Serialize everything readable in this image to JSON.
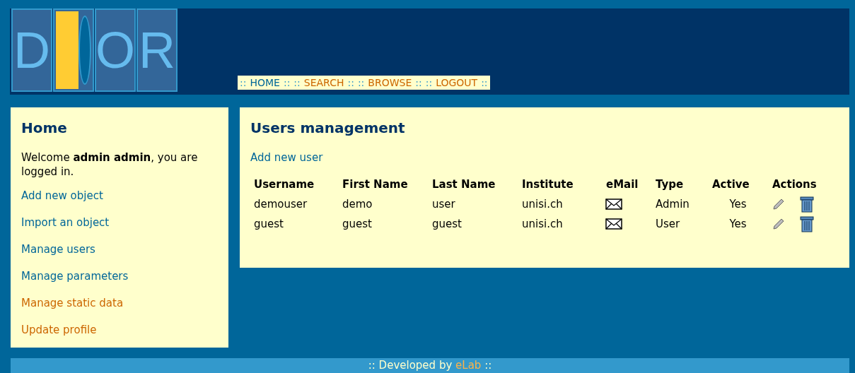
{
  "logo": {
    "tiles": [
      {
        "kind": "letter",
        "text": "D"
      },
      {
        "kind": "door"
      },
      {
        "kind": "letter",
        "text": "O"
      },
      {
        "kind": "letter",
        "text": "R"
      }
    ]
  },
  "nav": {
    "separator": "::",
    "items": [
      {
        "label": "HOME",
        "selected": true
      },
      {
        "label": "SEARCH",
        "selected": false
      },
      {
        "label": "BROWSE",
        "selected": false
      },
      {
        "label": "LOGOUT",
        "selected": false
      }
    ]
  },
  "sidebar": {
    "title": "Home",
    "welcome": "Welcome **admin admin**, you are logged in.",
    "links": [
      {
        "label": "Add new object",
        "visited": false
      },
      {
        "label": "Import an object",
        "visited": false
      },
      {
        "label": "Manage users",
        "visited": false
      },
      {
        "label": "Manage parameters",
        "visited": false
      },
      {
        "label": "Manage static data",
        "visited": true
      },
      {
        "label": "Update profile",
        "visited": true
      }
    ]
  },
  "main": {
    "title": "Users management",
    "add_link": "Add new user",
    "table": {
      "columns": [
        "Username",
        "First Name",
        "Last Name",
        "Institute",
        "eMail",
        "Type",
        "Active",
        "Actions"
      ],
      "rows": [
        {
          "username": "demouser",
          "first_name": "demo",
          "last_name": "user",
          "institute": "unisi.ch",
          "type": "Admin",
          "active": "Yes"
        },
        {
          "username": "guest",
          "first_name": "guest",
          "last_name": "guest",
          "institute": "unisi.ch",
          "type": "User",
          "active": "Yes"
        }
      ]
    }
  },
  "footer": {
    "text": ":: Developed by",
    "link": "eLab",
    "end": "::"
  }
}
